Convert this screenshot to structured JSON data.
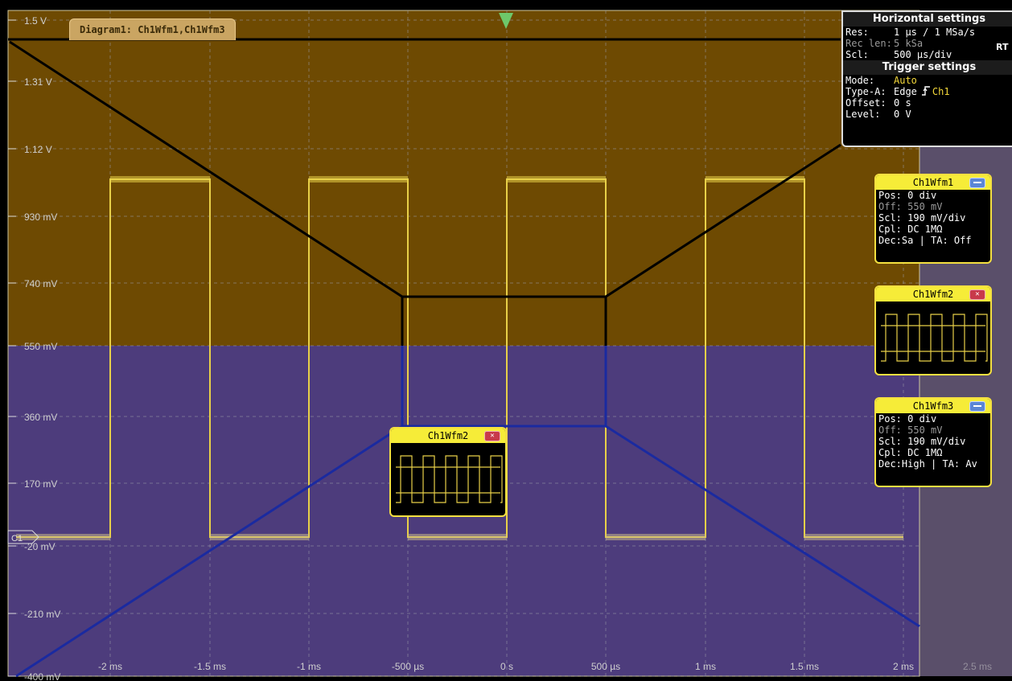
{
  "diagram": {
    "tab_label": "Diagram1: Ch1Wfm1,Ch1Wfm3",
    "y_labels": [
      "1.5 V",
      "1.31 V",
      "1.12 V",
      "930 mV",
      "740 mV",
      "550 mV",
      "360 mV",
      "170 mV",
      "-20 mV",
      "-210 mV",
      "-400 mV"
    ],
    "x_labels": [
      "-2 ms",
      "-1.5 ms",
      "-1 ms",
      "-500 µs",
      "0 s",
      "500 µs",
      "1 ms",
      "1.5 ms",
      "2 ms",
      "2.5 ms"
    ],
    "channel_marker": "C1",
    "colors": {
      "upper_bg": "#6e4a02",
      "lower_bg": "#4d3c7c",
      "grid": "#9a9aa8",
      "trace_yellow": "#e8d048",
      "trace_black": "#000000",
      "trace_blue": "#1a2aa0",
      "trigger_marker": "#6ec86a"
    }
  },
  "horizontal_settings": {
    "title": "Horizontal settings",
    "rows": [
      {
        "key": "Res:",
        "value": "1 µs / 1 MSa/s"
      },
      {
        "key": "Rec len:",
        "value": "5 kSa"
      },
      {
        "key": "Scl:",
        "value": "500 µs/div"
      }
    ],
    "mode_badge": "RT"
  },
  "trigger_settings": {
    "title": "Trigger settings",
    "rows": [
      {
        "key": "Mode:",
        "value": "Auto"
      },
      {
        "key": "Type-A:",
        "value": "Edge",
        "source": "Ch1"
      },
      {
        "key": "Offset:",
        "value": "0 s"
      },
      {
        "key": "Level:",
        "value": "0 V"
      }
    ],
    "edge_icon": "rising-edge-icon"
  },
  "waveforms": {
    "ch1wfm1": {
      "title": "Ch1Wfm1",
      "lines": [
        "Pos: 0 div",
        "Off: 550 mV",
        "Scl: 190 mV/div",
        "Cpl: DC 1MΩ",
        "Dec:Sa | TA: Off"
      ]
    },
    "ch1wfm2": {
      "title": "Ch1Wfm2"
    },
    "ch1wfm3": {
      "title": "Ch1Wfm3",
      "lines": [
        "Pos: 0 div",
        "Off: 550 mV",
        "Scl: 190 mV/div",
        "Cpl: DC 1MΩ",
        "Dec:High | TA: Av"
      ]
    },
    "floating_ch1wfm2": {
      "title": "Ch1Wfm2"
    }
  }
}
